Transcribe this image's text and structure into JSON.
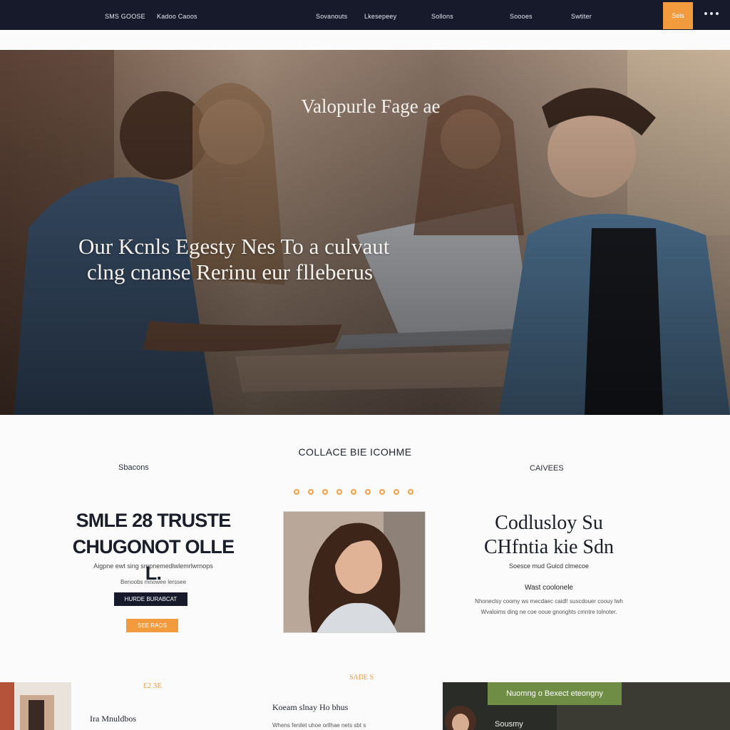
{
  "nav": {
    "links": [
      "SMS GOOSE",
      "Kadoo Caoos",
      "Sovanouts",
      "Lkesepeey",
      "Sollons",
      "Soooes",
      "Swtiter"
    ],
    "cta_label": "Sels",
    "menu_icon": "dots-menu-icon",
    "colors": {
      "bar": "#161a2a",
      "accent": "#f19a3e"
    }
  },
  "hero": {
    "kicker": "Valopurle Fage ae",
    "title_line1": "Our Kcnls Egesty Nes  To a culvaut",
    "title_line2": "clng cnanse Rerinu eur flleberus"
  },
  "section": {
    "heading": "COLLACE BIE ICOHME",
    "label_left": "Sbacons",
    "label_right": "CAIVEES",
    "dot_count": 9,
    "left": {
      "heading_line1": "SMLE 28 TRUSTE",
      "heading_line2": "CHUGONOT OLLE L.",
      "subtitle": "Aigpne ewt sing smpnemedlwlemrlwrnops",
      "small_text": "Benoobs mnowee lerssee",
      "button_dark": "HURDE BURABCAT",
      "button_orange": "SEE RAOS"
    },
    "right": {
      "heading_line1": "Codlusloy Su",
      "heading_line2": "CHfntia kie Sdn",
      "subtitle": "Soesce mud Guicd clmecoe",
      "subtitle2": "Wast coolonele",
      "paragraph": "Nhoneclsy coomy ws mecdaec caidl! suscdouer coouy lwh Wvaloims ding ne coe ooue gnonghts cmntre tolnoter."
    }
  },
  "bottom": {
    "orange_left": "£2 3E",
    "left_title": "Ira Mnuldbos",
    "orange_mid": "SADE S",
    "mid_title": "Koeam slnay Ho bhus",
    "mid_text": "Whens fenilet uhoe orllhae nets sbt s",
    "green_badge": "Nuomng o Bexect eteongny",
    "right_label": "Sousmy",
    "colors": {
      "green": "#6f8d44"
    }
  }
}
